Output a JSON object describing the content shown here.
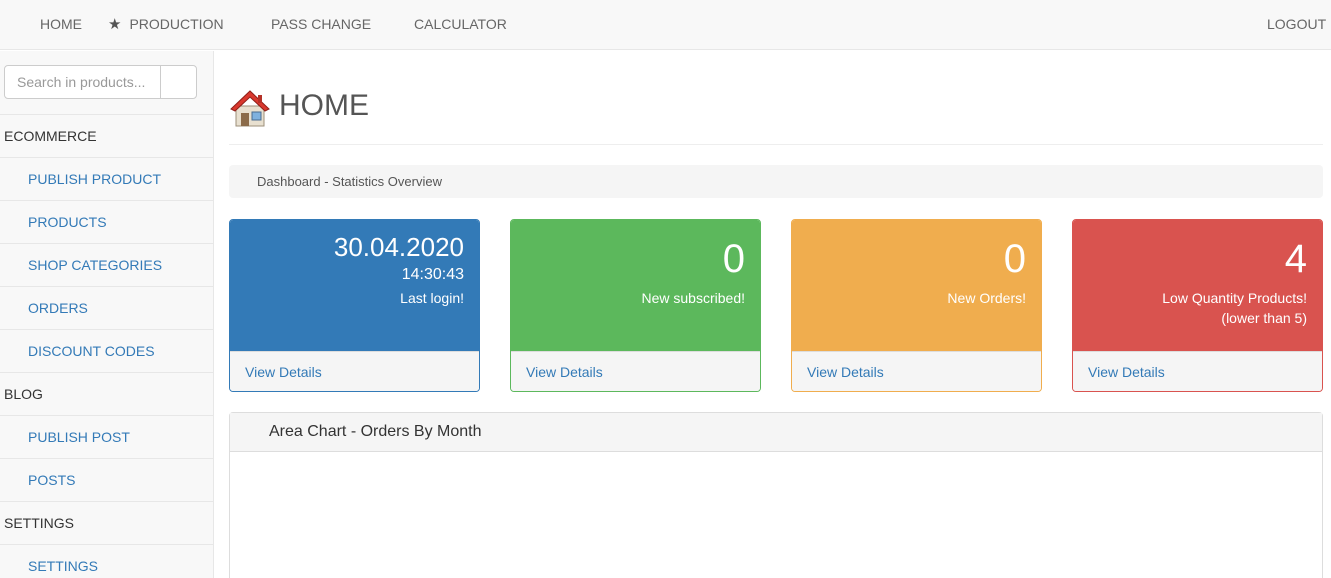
{
  "nav": {
    "home": "HOME",
    "production": "PRODUCTION",
    "pass_change": "PASS CHANGE",
    "calculator": "CALCULATOR",
    "logout": "LOGOUT"
  },
  "sidebar": {
    "search_placeholder": "Search in products...",
    "items": [
      {
        "label": "ECOMMERCE"
      },
      {
        "label": "PUBLISH PRODUCT"
      },
      {
        "label": "PRODUCTS"
      },
      {
        "label": "SHOP CATEGORIES"
      },
      {
        "label": "ORDERS"
      },
      {
        "label": "DISCOUNT CODES"
      },
      {
        "label": "BLOG"
      },
      {
        "label": "PUBLISH POST"
      },
      {
        "label": "POSTS"
      },
      {
        "label": "SETTINGS"
      },
      {
        "label": "SETTINGS"
      }
    ]
  },
  "page": {
    "title": "HOME",
    "breadcrumb": "Dashboard - Statistics Overview"
  },
  "panels": {
    "login": {
      "date": "30.04.2020",
      "time": "14:30:43",
      "label": "Last login!",
      "link": "View Details",
      "color": "#337ab7"
    },
    "subscribed": {
      "value": "0",
      "label": "New subscribed!",
      "link": "View Details",
      "color": "#5cb85c"
    },
    "orders": {
      "value": "0",
      "label": "New Orders!",
      "link": "View Details",
      "color": "#f0ad4e"
    },
    "low_qty": {
      "value": "4",
      "label": "Low Quantity Products!",
      "label2": "(lower than 5)",
      "link": "View Details",
      "color": "#d9534f"
    }
  },
  "chart_panel": {
    "title": "Area Chart - Orders By Month"
  },
  "icons": {
    "production": "star-icon",
    "title": "house-icon"
  }
}
